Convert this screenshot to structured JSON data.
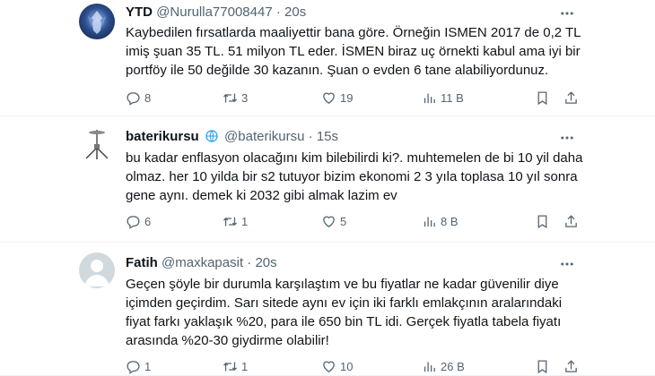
{
  "tweets": [
    {
      "name": "YTD",
      "handle": "@Nurulla77008447",
      "dot": "·",
      "time": "20s",
      "verified": false,
      "text": "Kaybedilen fırsatlarda maaliyettir bana göre.  Örneğin ISMEN 2017 de 0,2 TL imiş şuan 35 TL. 51 milyon TL eder.  İSMEN biraz uç örnekti kabul ama iyi bir portföy ile 50 değilde 30 kazanın.  Şuan o evden 6 tane alabiliyordunuz.",
      "replies": "8",
      "retweets": "3",
      "likes": "19",
      "views": "11 B"
    },
    {
      "name": "baterikursu",
      "handle": "@baterikursu",
      "dot": "·",
      "time": "15s",
      "verified": true,
      "text": "bu kadar enflasyon olacağını kim bilebilirdi ki?. muhtemelen de bi 10 yil daha olmaz. her 10 yilda bir s2 tutuyor bizim ekonomi 2 3 yıla toplasa 10 yıl sonra gene aynı. demek ki 2032 gibi almak lazim ev",
      "replies": "6",
      "retweets": "1",
      "likes": "5",
      "views": "8 B"
    },
    {
      "name": "Fatih",
      "handle": "@maxkapasit",
      "dot": "·",
      "time": "20s",
      "verified": false,
      "text": "Geçen şöyle bir durumla karşılaştım ve bu fiyatlar ne kadar güvenilir diye içimden geçirdim. Sarı sitede aynı ev için iki farklı emlakçının aralarındaki fiyat farkı yaklaşık %20, para ile 650 bin TL idi. Gerçek fiyatla tabela fiyatı arasında %20-30 giydirme olabilir!",
      "replies": "1",
      "retweets": "1",
      "likes": "10",
      "views": "26 B"
    }
  ],
  "icons": {
    "more": "more-horizontal-icon",
    "reply": "reply-icon",
    "retweet": "retweet-icon",
    "like": "heart-icon",
    "views": "views-bar-chart-icon",
    "bookmark": "bookmark-icon",
    "share": "share-icon",
    "verified": "verified-badge-icon"
  },
  "colors": {
    "text_primary": "#0f1419",
    "text_secondary": "#536471",
    "verified": "#1d9bf0",
    "divider": "#eff3f4"
  }
}
